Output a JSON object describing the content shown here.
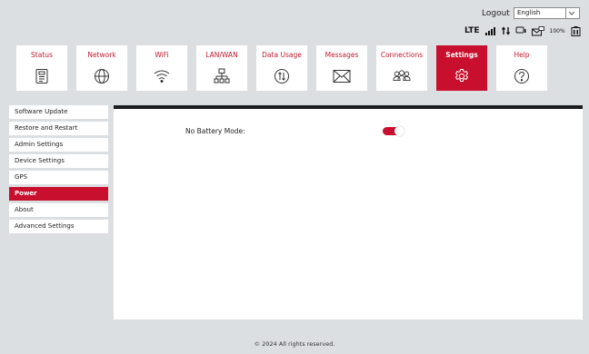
{
  "header": {
    "logout_label": "Logout",
    "language_selected": "English",
    "network_type": "LTE",
    "battery_percent": "100%"
  },
  "tabs": [
    {
      "label": "Status",
      "icon": "status-icon"
    },
    {
      "label": "Network",
      "icon": "globe-icon"
    },
    {
      "label": "WiFi",
      "icon": "wifi-icon"
    },
    {
      "label": "LAN/WAN",
      "icon": "lan-icon"
    },
    {
      "label": "Data Usage",
      "icon": "data-usage-icon"
    },
    {
      "label": "Messages",
      "icon": "envelope-icon"
    },
    {
      "label": "Connections",
      "icon": "users-icon"
    },
    {
      "label": "Settings",
      "icon": "gear-icon",
      "active": true
    },
    {
      "label": "Help",
      "icon": "help-icon"
    }
  ],
  "sidebar": {
    "items": [
      {
        "label": "Software Update"
      },
      {
        "label": "Restore and Restart"
      },
      {
        "label": "Admin Settings"
      },
      {
        "label": "Device Settings"
      },
      {
        "label": "GPS"
      },
      {
        "label": "Power",
        "active": true
      },
      {
        "label": "About"
      },
      {
        "label": "Advanced Settings"
      }
    ]
  },
  "main": {
    "no_battery_mode_label": "No Battery Mode:",
    "no_battery_mode_enabled": true
  },
  "footer": {
    "copyright": "© 2024 All rights reserved."
  },
  "colors": {
    "accent": "#c8102e",
    "background": "#dcdfe2"
  }
}
